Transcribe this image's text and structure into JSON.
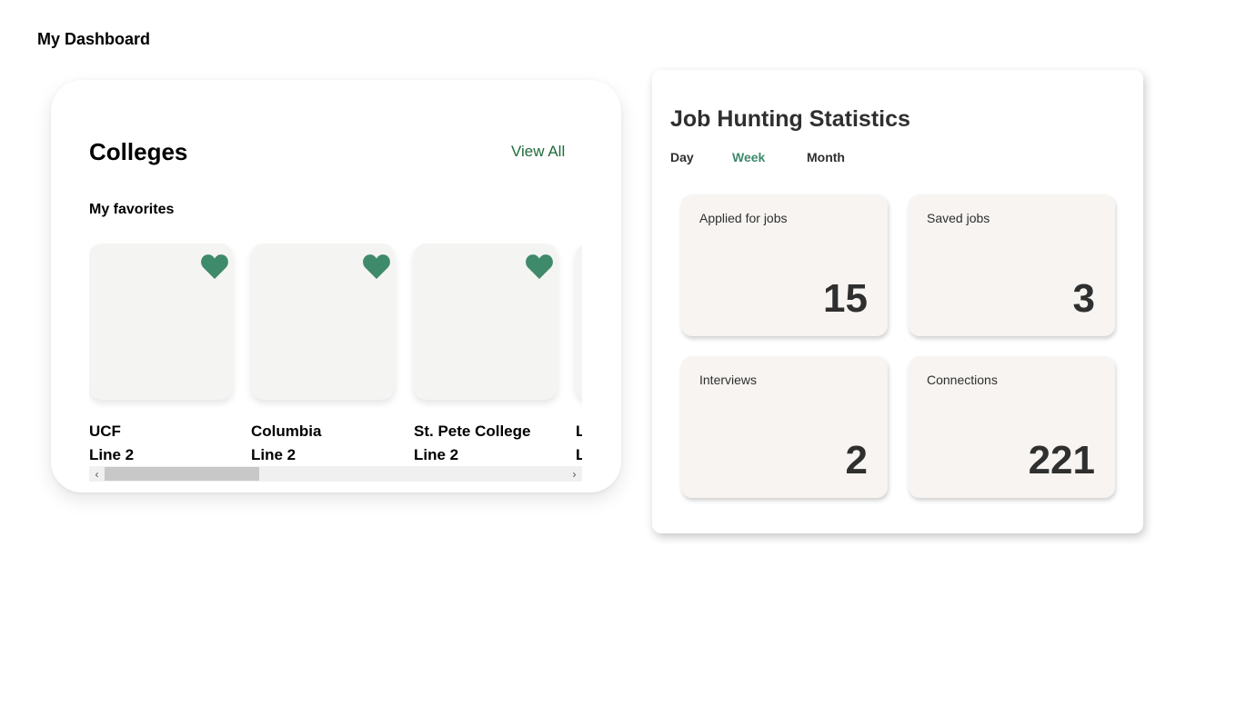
{
  "page": {
    "title": "My Dashboard"
  },
  "colleges": {
    "title": "Colleges",
    "view_all_label": "View All",
    "favorites_label": "My favorites",
    "items": [
      {
        "name": "UCF",
        "line2": "Line 2",
        "favorited": true
      },
      {
        "name": "Columbia",
        "line2": "Line 2",
        "favorited": true
      },
      {
        "name": "St. Pete College",
        "line2": "Line 2",
        "favorited": true
      },
      {
        "name": "L",
        "line2": "L",
        "favorited": true
      }
    ],
    "heart_color": "#3e8a6a"
  },
  "stats": {
    "title": "Job Hunting Statistics",
    "tabs": [
      {
        "label": "Day",
        "active": false
      },
      {
        "label": "Week",
        "active": true
      },
      {
        "label": "Month",
        "active": false
      }
    ],
    "boxes": [
      {
        "label": "Applied for jobs",
        "value": "15"
      },
      {
        "label": "Saved jobs",
        "value": "3"
      },
      {
        "label": "Interviews",
        "value": "2"
      },
      {
        "label": "Connections",
        "value": "221"
      }
    ],
    "accent_color": "#3e8a6a"
  }
}
